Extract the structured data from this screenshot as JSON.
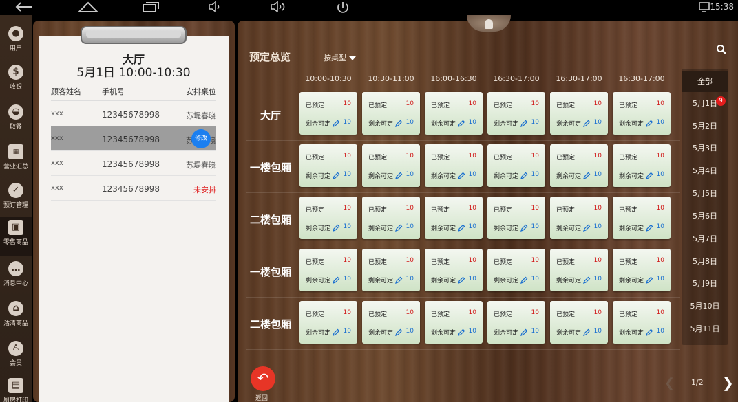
{
  "status_bar": {
    "time": "15:38",
    "icons": [
      "back-icon",
      "home-icon",
      "recent-apps-icon",
      "volume-down-icon",
      "volume-up-icon",
      "power-icon",
      "screen-icon"
    ]
  },
  "nav": [
    {
      "label": "用户",
      "icon": "user-icon"
    },
    {
      "label": "收银",
      "icon": "cash-icon"
    },
    {
      "label": "取餐",
      "icon": "meal-icon"
    },
    {
      "label": "营业汇总",
      "icon": "summary-icon"
    },
    {
      "label": "预订管理",
      "icon": "reservation-icon"
    },
    {
      "label": "零售商品",
      "icon": "bag-icon"
    },
    {
      "label": "消息中心",
      "icon": "message-icon"
    },
    {
      "label": "沽清商品",
      "icon": "soldout-icon"
    },
    {
      "label": "会员",
      "icon": "member-icon"
    },
    {
      "label": "厨房打印",
      "icon": "printer-icon"
    }
  ],
  "left": {
    "hall": "大厅",
    "time": "5月1日 10:00-10:30",
    "headers": [
      "顾客姓名",
      "手机号",
      "安排桌位"
    ],
    "rows": [
      {
        "name": "xxx",
        "phone": "12345678998",
        "table": "苏堤春晓"
      },
      {
        "name": "xxx",
        "phone": "12345678998",
        "table": "苏堤春晓",
        "edit": "修改"
      },
      {
        "name": "xxx",
        "phone": "12345678998",
        "table": "苏堤春晓"
      },
      {
        "name": "xxx",
        "phone": "12345678998",
        "table": "未安排"
      }
    ]
  },
  "main": {
    "title": "预定总览",
    "filter": "按桌型",
    "columns": [
      "10:00-10:30",
      "10:30-11:00",
      "16:00-16:30",
      "16:30-17:00",
      "16:30-17:00",
      "16:30-17:00"
    ],
    "rows": [
      "大厅",
      "一楼包厢",
      "二楼包厢",
      "一楼包厢",
      "二楼包厢"
    ],
    "card": {
      "booked_label": "已预定",
      "booked": "10",
      "remain_label": "剩余可定",
      "remain": "10"
    }
  },
  "dates": {
    "all": "全部",
    "items": [
      "5月1日",
      "5月2日",
      "5月3日",
      "5月4日",
      "5月5日",
      "5月6日",
      "5月7日",
      "5月8日",
      "5月9日",
      "5月10日",
      "5月11日"
    ],
    "badge": "9"
  },
  "pager": {
    "text": "1/2"
  },
  "back": {
    "label": "返回"
  },
  "colors": {
    "accent_red": "#e73526",
    "edit_blue": "#1b7ff0",
    "card_green": "#cfe3c6"
  }
}
